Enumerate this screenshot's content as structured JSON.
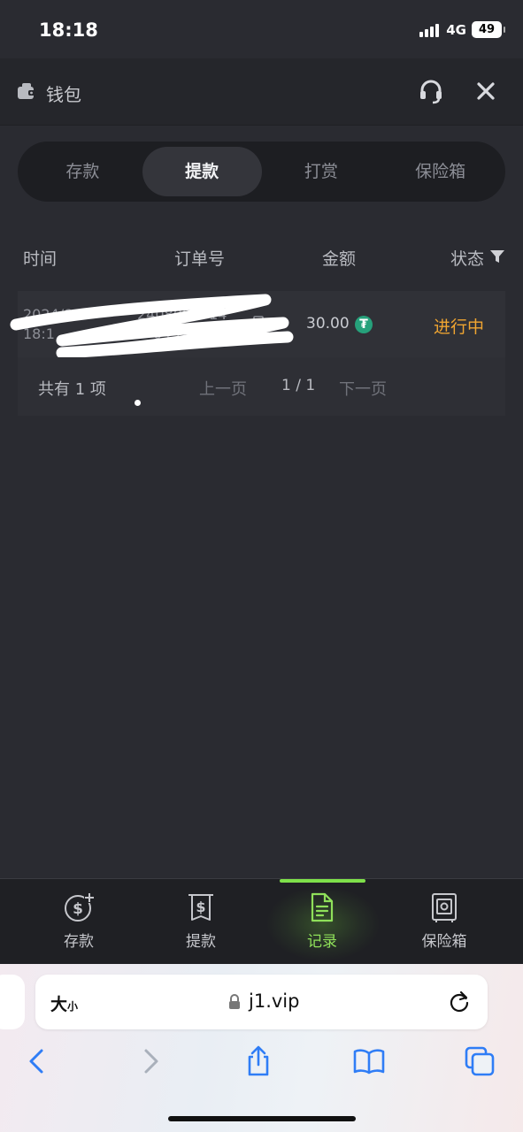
{
  "status_bar": {
    "time": "18:18",
    "network": "4G",
    "battery": "49"
  },
  "header": {
    "title": "钱包",
    "icons": [
      "wallet-icon",
      "headset-icon",
      "close-icon"
    ]
  },
  "tabs": [
    {
      "label": "存款",
      "active": false
    },
    {
      "label": "提款",
      "active": true
    },
    {
      "label": "打赏",
      "active": false
    },
    {
      "label": "保险箱",
      "active": false
    }
  ],
  "table": {
    "columns": [
      "时间",
      "订单号",
      "金额",
      "状态"
    ],
    "rows": [
      {
        "date_line1": "2024/8/9",
        "date_line2": "18:1",
        "order_line1": "240809",
        "order_line1b": "14",
        "order_line2": "0459",
        "amount": "30.00",
        "currency_symbol": "₮",
        "status": "进行中"
      }
    ]
  },
  "pagination": {
    "total": "共有 1 项",
    "prev": "上一页",
    "page": "1 / 1",
    "next": "下一页"
  },
  "bottom_nav": [
    {
      "label": "存款",
      "icon": "dollar-plus-icon",
      "active": false
    },
    {
      "label": "提款",
      "icon": "withdraw-dollar-icon",
      "active": false
    },
    {
      "label": "记录",
      "icon": "document-icon",
      "active": true
    },
    {
      "label": "保险箱",
      "icon": "safe-icon",
      "active": false
    }
  ],
  "browser": {
    "textsize_big": "大",
    "textsize_small": "小",
    "url": "j1.vip",
    "toolbar": [
      "back-icon",
      "forward-icon",
      "share-icon",
      "bookmarks-icon",
      "tabs-icon"
    ]
  },
  "colors": {
    "background": "#2a2b31",
    "accent_green": "#7ee04a",
    "status_orange": "#f0a531",
    "usdt_green": "#26a17b"
  }
}
